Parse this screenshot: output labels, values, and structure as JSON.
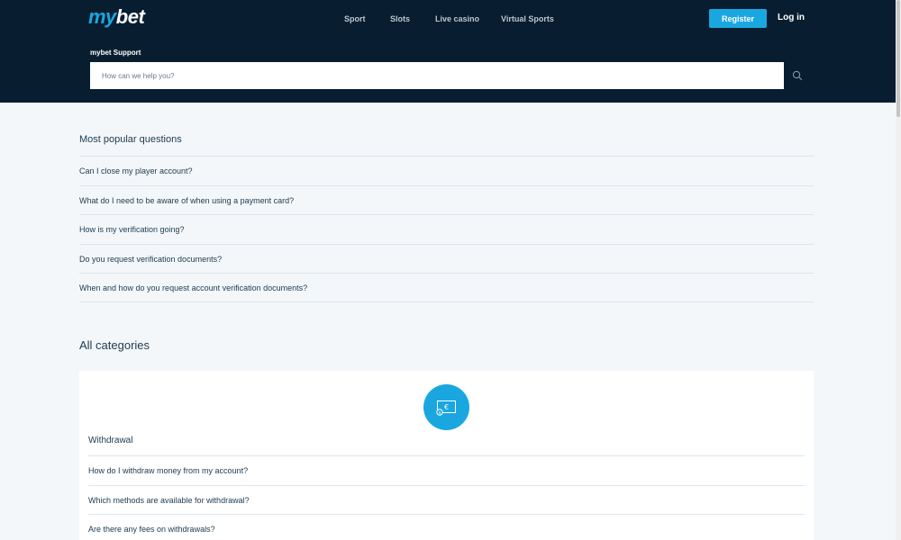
{
  "header": {
    "logo_my": "my",
    "logo_bet": "bet",
    "nav": [
      "Sport",
      "Slots",
      "Live casino",
      "Virtual Sports"
    ],
    "register_label": "Register",
    "login_label": "Log in"
  },
  "support": {
    "label": "mybet Support",
    "search_placeholder": "How can we help you?"
  },
  "popular": {
    "title": "Most popular questions",
    "questions": [
      "Can I close my player account?",
      "What do I need to be aware of when using a payment card?",
      "How is my verification going?",
      "Do you request verification documents?",
      "When and how do you request account verification documents?"
    ]
  },
  "categories": {
    "title": "All categories",
    "withdrawal": {
      "name": "Withdrawal",
      "icon": "money-bill-euro-icon",
      "questions": [
        "How do I withdraw money from my account?",
        "Which methods are available for withdrawal?",
        "Are there any fees on withdrawals?"
      ]
    }
  },
  "colors": {
    "header_bg": "#081e30",
    "accent": "#1aa7e0",
    "page_bg": "#f4f7fa",
    "text": "#1c3a4f"
  }
}
